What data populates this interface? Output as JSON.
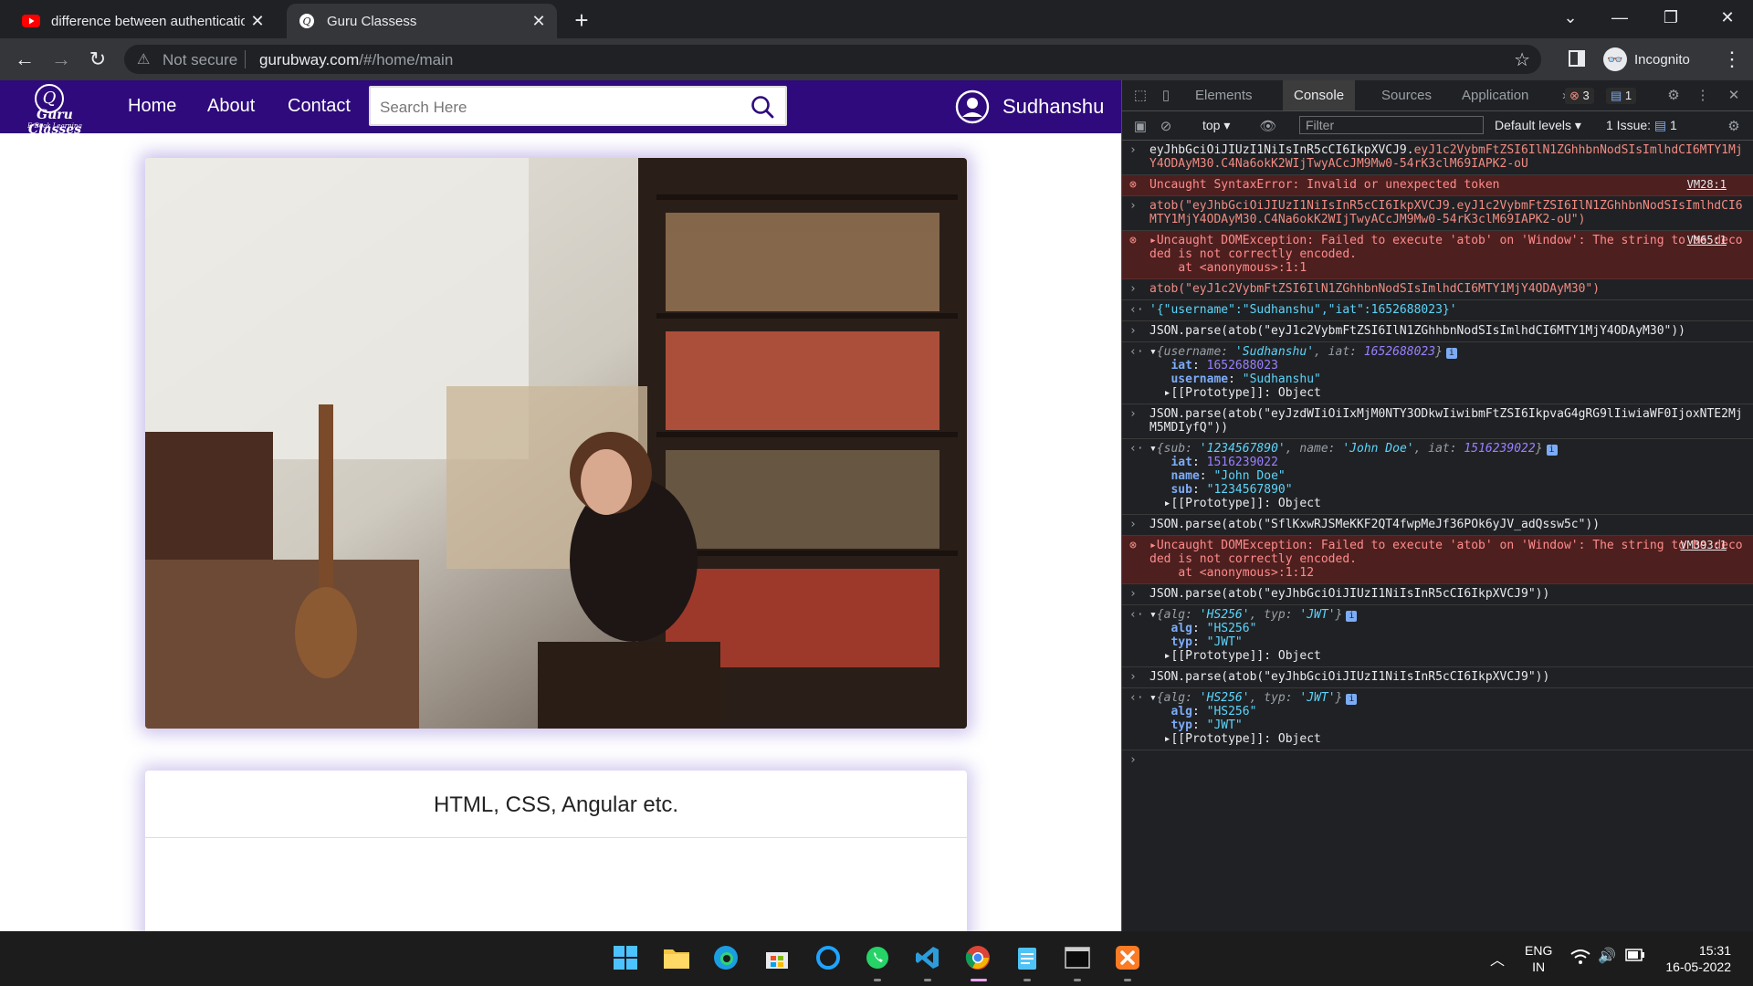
{
  "browser": {
    "tabs": [
      {
        "title": "difference between authenticatio",
        "close": "✕"
      },
      {
        "title": "Guru Classess",
        "close": "✕"
      }
    ],
    "new_tab": "+",
    "not_secure": "Not secure",
    "url_domain": "gurubway.com",
    "url_path": "/#/home/main",
    "profile_label": "Incognito"
  },
  "site": {
    "logo": {
      "mark": "Q",
      "name": "Guru Classes",
      "tagline": "E-Book Learning"
    },
    "nav": {
      "home": "Home",
      "about": "About",
      "contact": "Contact"
    },
    "search_placeholder": "Search Here",
    "username": "Sudhanshu",
    "card_title": "HTML, CSS, Angular etc."
  },
  "devtools": {
    "tabs": {
      "elements": "Elements",
      "console": "Console",
      "sources": "Sources",
      "application": "Application",
      "more": "»"
    },
    "error_count": "3",
    "message_count": "1",
    "context": "top",
    "filter_placeholder": "Filter",
    "levels": "Default levels",
    "issues_label": "1 Issue:",
    "issues_count": "1",
    "console": {
      "l1": "eyJhbGciOiJIUzI1NiIsInR5cCI6IkpXVCJ9.",
      "l1b": "eyJ1c2VybmFtZSI6IlN1ZGhhbnNodSIsImlhdCI6MTY1MjY4ODAyM30.C4Na6okK2WIjTwyACcJM9Mw0-54rK3clM69IAPK2-oU",
      "e1": "Uncaught SyntaxError: Invalid or unexpected token",
      "e1src": "VM28:1",
      "l2": "atob(\"eyJhbGciOiJIUzI1NiIsInR5cCI6IkpXVCJ9.eyJ1c2VybmFtZSI6IlN1ZGhhbnNodSIsImlhdCI6MTY1MjY4ODAyM30.C4Na6okK2WIjTwyACcJM9Mw0-54rK3clM69IAPK2-oU\")",
      "e2": "Uncaught DOMException: Failed to execute 'atob' on 'Window': The string to be decoded is not correctly encoded.",
      "e2at": "at <anonymous>:1:1",
      "e2src": "VM65:1",
      "l3": "atob(\"eyJ1c2VybmFtZSI6IlN1ZGhhbnNodSIsImlhdCI6MTY1MjY4ODAyM30\")",
      "o3": "'{\"username\":\"Sudhanshu\",\"iat\":1652688023}'",
      "l4": "JSON.parse(atob(\"eyJ1c2VybmFtZSI6IlN1ZGhhbnNodSIsImlhdCI6MTY1MjY4ODAyM30\"))",
      "o4_user": "'Sudhanshu'",
      "o4_iat": "1652688023",
      "o4_iat_val": "1652688023",
      "o4_user_val": "\"Sudhanshu\"",
      "proto": "[[Prototype]]: Object",
      "l5": "JSON.parse(atob(\"eyJzdWIiOiIxMjM0NTY3ODkwIiwibmFtZSI6IkpvaG4gRG9lIiwiaWF0IjoxNTE2MjM5MDIyfQ\"))",
      "o5_sub": "'1234567890'",
      "o5_name": "'John Doe'",
      "o5_iat": "1516239022",
      "o5_iat_val": "1516239022",
      "o5_name_val": "\"John Doe\"",
      "o5_sub_val": "\"1234567890\"",
      "l6": "JSON.parse(atob(\"SflKxwRJSMeKKF2QT4fwpMeJf36POk6yJV_adQssw5c\"))",
      "e3at": "at <anonymous>:1:12",
      "e3src": "VM393:1",
      "l7": "JSON.parse(atob(\"eyJhbGciOiJIUzI1NiIsInR5cCI6IkpXVCJ9\"))",
      "o7_alg": "'HS256'",
      "o7_typ": "'JWT'",
      "o7_alg_val": "\"HS256\"",
      "o7_typ_val": "\"JWT\"",
      "l8": "JSON.parse(atob(\"eyJhbGciOiJIUzI1NiIsInR5cCI6IkpXVCJ9\"))"
    }
  },
  "taskbar": {
    "lang1": "ENG",
    "lang2": "IN",
    "time": "15:31",
    "date": "16-05-2022"
  }
}
